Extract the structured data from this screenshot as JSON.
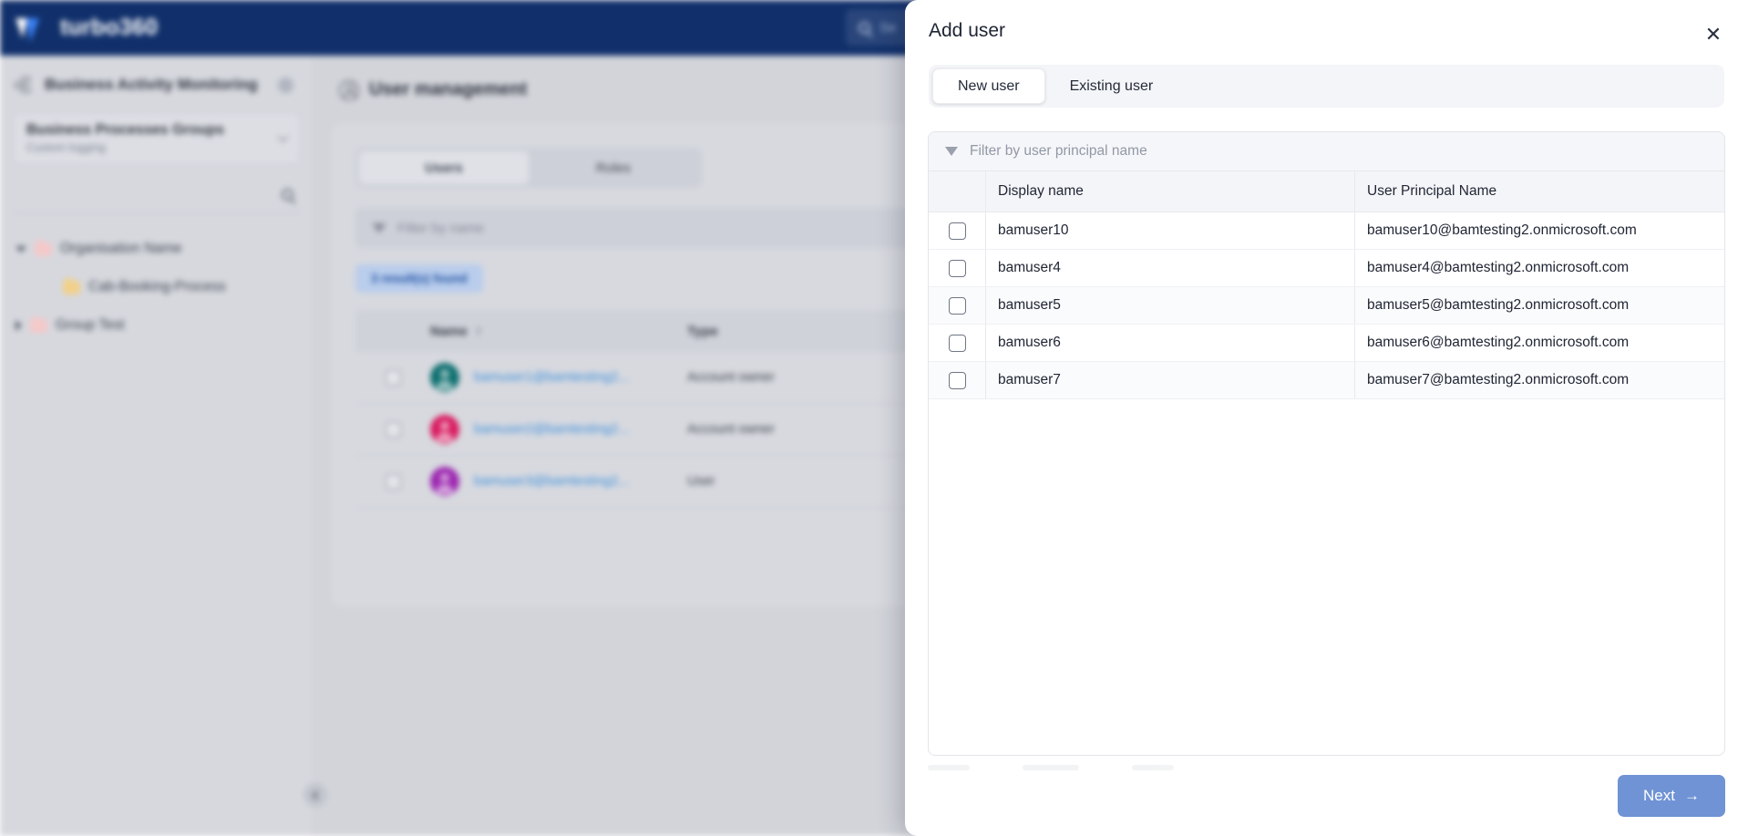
{
  "app": {
    "brand": "turbo360",
    "top_search_placeholder": "Se",
    "logo_icon": "turbo360-leaf-logo"
  },
  "sidebar": {
    "section_title": "Business Activity Monitoring",
    "settings_icon": "gear-icon",
    "bam_icon": "activity-nodes-icon",
    "process_card": {
      "title": "Business Processes Groups",
      "subtitle": "Custom logging",
      "chevron_icon": "chevron-down-icon"
    },
    "search_icon": "search-icon",
    "tree": [
      {
        "label": "Organisation Name",
        "level": 0,
        "expanded": true,
        "folder_color": "red"
      },
      {
        "label": "Cab-Booking-Process",
        "level": 1,
        "expanded": null,
        "folder_color": "yellow"
      },
      {
        "label": "Group Test",
        "level": 0,
        "expanded": false,
        "folder_color": "red"
      }
    ],
    "collapse_icon": "chevron-left-icon"
  },
  "main": {
    "page_title": "User management",
    "page_icon": "user-management-icon",
    "tabs": [
      {
        "label": "Users",
        "active": true
      },
      {
        "label": "Roles",
        "active": false
      }
    ],
    "filter_placeholder": "Filter by name",
    "filter_icon": "funnel-icon",
    "results_badge": "3 result(s) found",
    "table": {
      "columns": [
        "Name",
        "Type"
      ],
      "sort_indicator": "↑",
      "rows": [
        {
          "email": "bamuser1@bamtesting2...",
          "type": "Account owner",
          "avatar_color": "#0d6e6e"
        },
        {
          "email": "bamuser2@bamtesting2...",
          "type": "Account owner",
          "avatar_color": "#d81b60"
        },
        {
          "email": "bamuser3@bamtesting2...",
          "type": "User",
          "avatar_color": "#9c27b0"
        }
      ]
    }
  },
  "modal": {
    "title": "Add user",
    "close_icon": "close-icon",
    "tabs": [
      {
        "label": "New user",
        "active": true
      },
      {
        "label": "Existing user",
        "active": false
      }
    ],
    "filter_placeholder": "Filter by user principal name",
    "filter_icon": "funnel-icon",
    "table": {
      "columns": [
        "",
        "Display name",
        "User Principal Name"
      ],
      "rows": [
        {
          "checked": false,
          "display_name": "bamuser10",
          "upn": "bamuser10@bamtesting2.onmicrosoft.com"
        },
        {
          "checked": false,
          "display_name": "bamuser4",
          "upn": "bamuser4@bamtesting2.onmicrosoft.com"
        },
        {
          "checked": false,
          "display_name": "bamuser5",
          "upn": "bamuser5@bamtesting2.onmicrosoft.com"
        },
        {
          "checked": false,
          "display_name": "bamuser6",
          "upn": "bamuser6@bamtesting2.onmicrosoft.com"
        },
        {
          "checked": false,
          "display_name": "bamuser7",
          "upn": "bamuser7@bamtesting2.onmicrosoft.com"
        }
      ]
    },
    "next_label": "Next",
    "next_arrow": "→",
    "next_color": "#6f93d4"
  }
}
